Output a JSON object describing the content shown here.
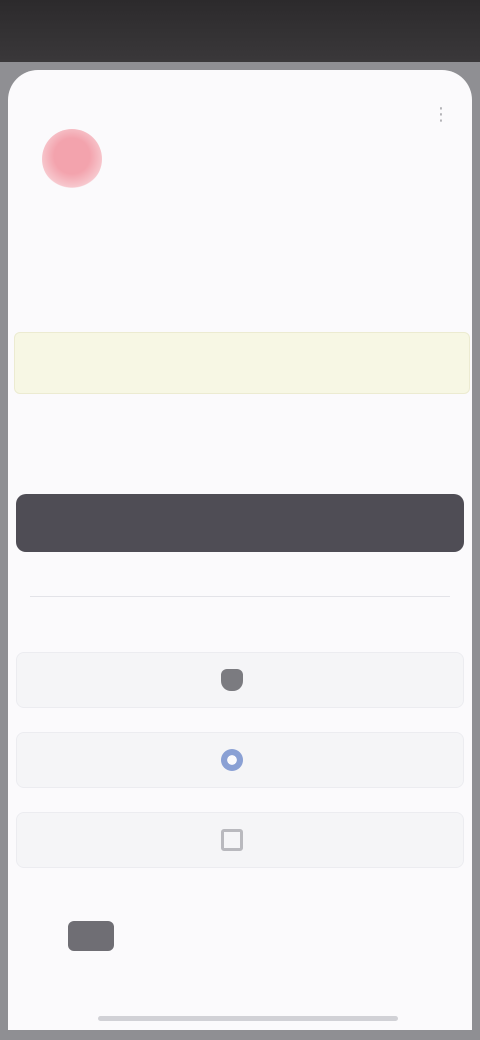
{
  "status_bar": {
    "time": "",
    "indicators": ""
  },
  "browser": {
    "url": "",
    "menu_icon": "more-icon"
  },
  "brand": {
    "wordmark": ""
  },
  "auth": {
    "title": "",
    "subtitle": "",
    "input_value": "",
    "input_placeholder": "",
    "remember_label": "",
    "help_link": "",
    "continue_label": "",
    "divider_label": ""
  },
  "social": [
    {
      "label": "",
      "icon": "apple-icon"
    },
    {
      "label": "",
      "icon": "google-icon"
    },
    {
      "label": "",
      "icon": "mail-icon"
    }
  ],
  "footer": {
    "text": ""
  },
  "colors": {
    "primary_button": "#4f4d55",
    "input_fill": "#f7f7e4",
    "brand_mark": "#f3a3ad"
  }
}
